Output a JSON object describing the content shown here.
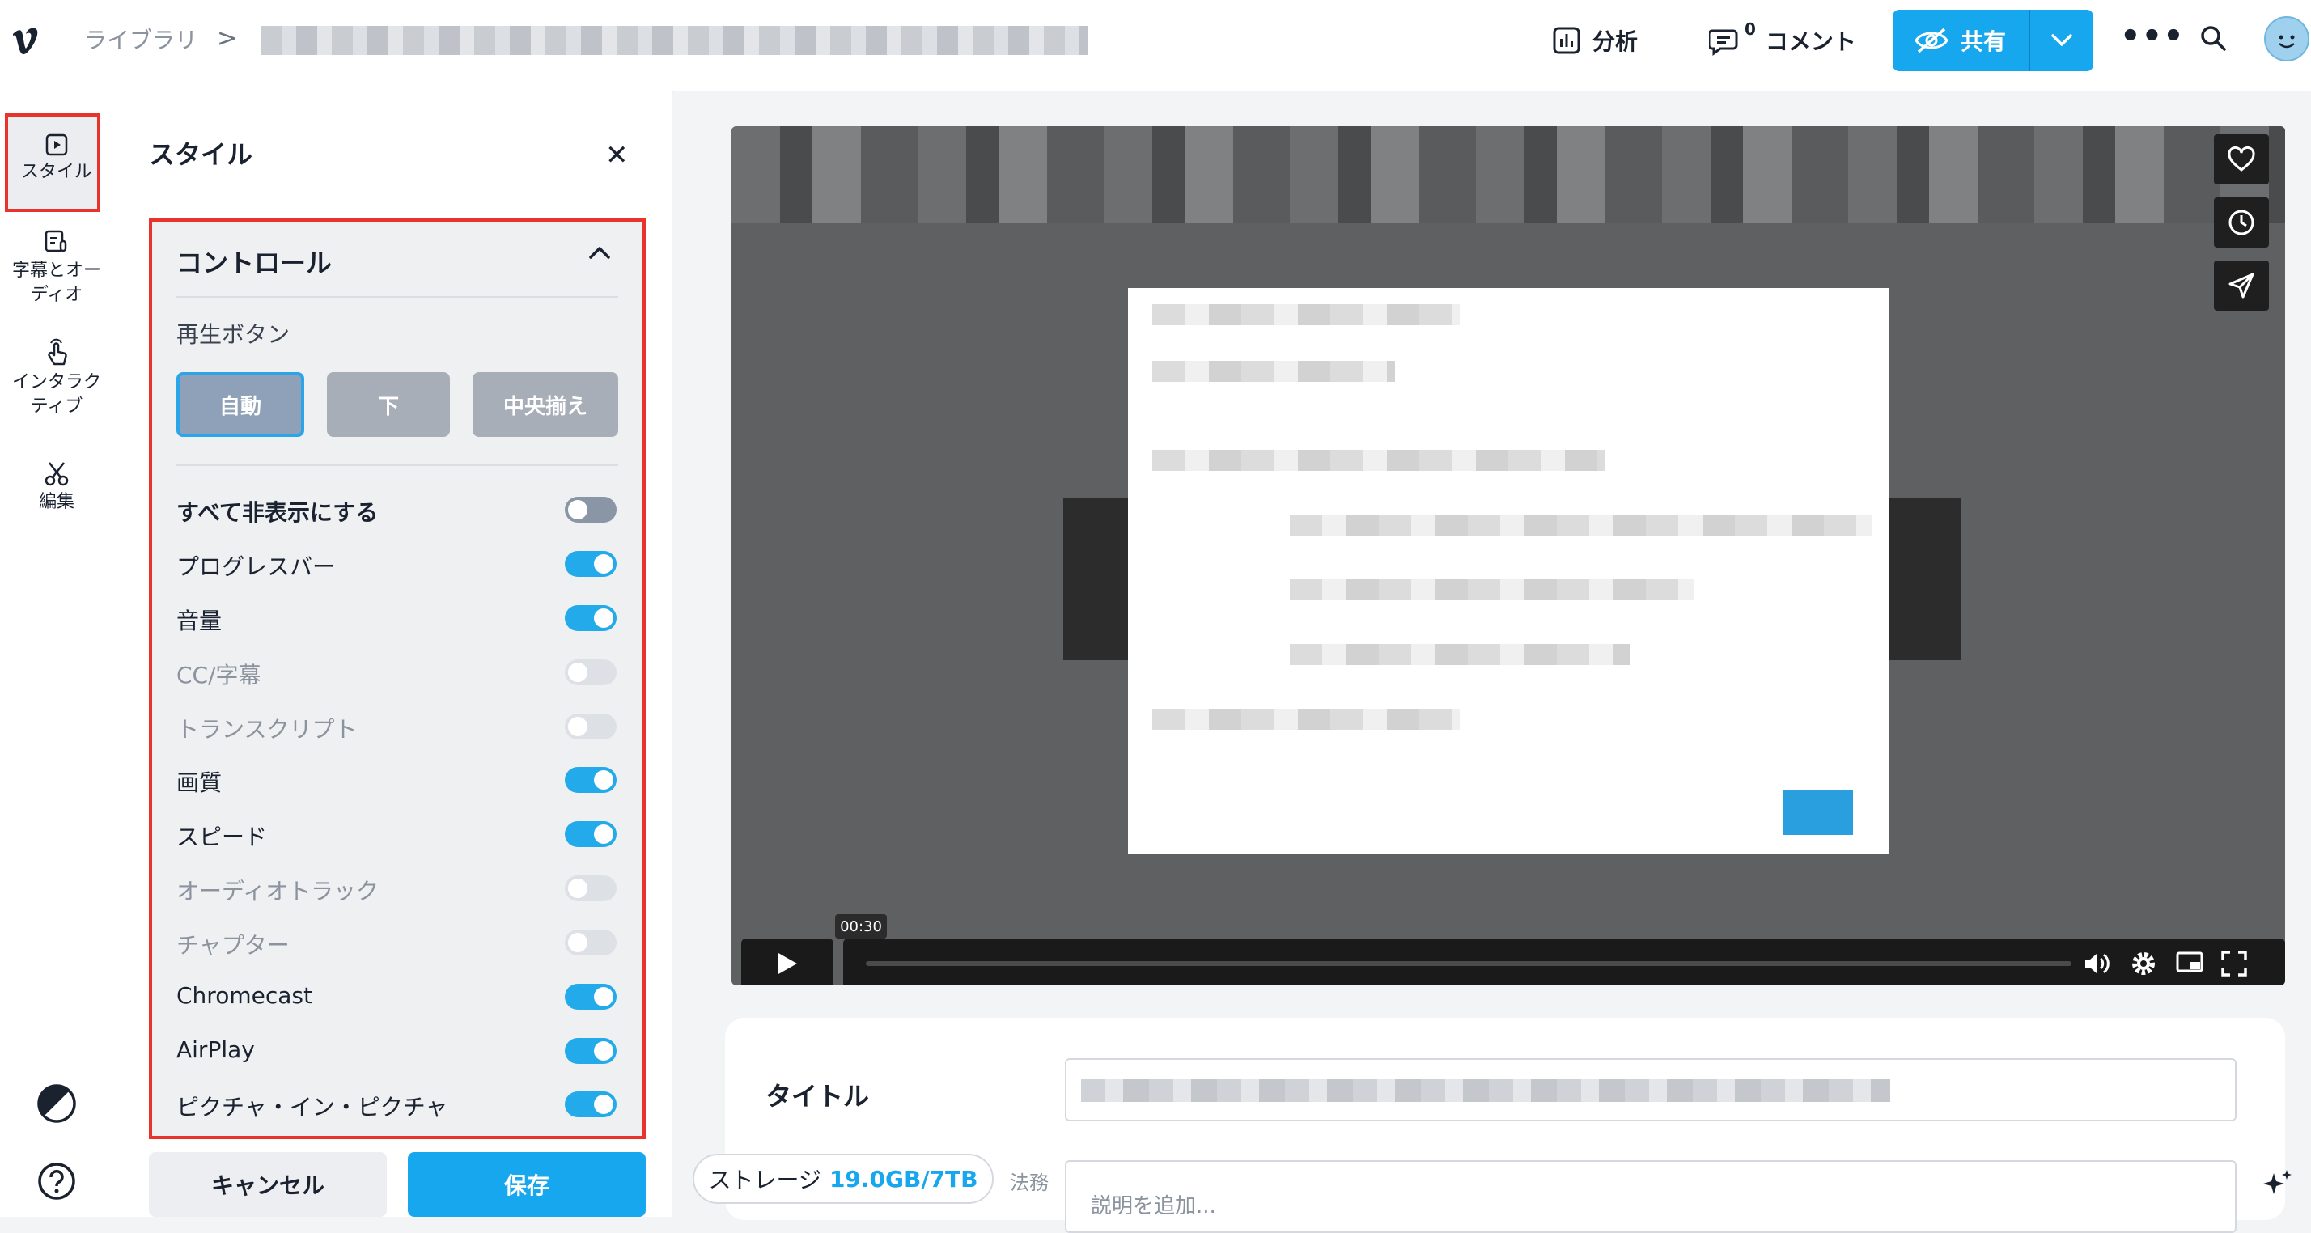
{
  "header": {
    "breadcrumb_library": "ライブラリ",
    "breadcrumb_separator": ">",
    "analytics_label": "分析",
    "comments_count": "0",
    "comments_label": "コメント",
    "share_label": "共有"
  },
  "rail": {
    "items": [
      {
        "label": "スタイル"
      },
      {
        "label": "字幕とオーディオ"
      },
      {
        "label": "インタラクティブ"
      },
      {
        "label": "編集"
      }
    ]
  },
  "panel": {
    "title": "スタイル",
    "controls_heading": "コントロール",
    "play_button_label": "再生ボタン",
    "play_button_options": [
      "自動",
      "下",
      "中央揃え"
    ],
    "toggles": [
      {
        "label": "すべて非表示にする",
        "state": "off",
        "bold": true
      },
      {
        "label": "プログレスバー",
        "state": "on"
      },
      {
        "label": "音量",
        "state": "on"
      },
      {
        "label": "CC/字幕",
        "state": "disabled"
      },
      {
        "label": "トランスクリプト",
        "state": "disabled"
      },
      {
        "label": "画質",
        "state": "on"
      },
      {
        "label": "スピード",
        "state": "on"
      },
      {
        "label": "オーディオトラック",
        "state": "disabled"
      },
      {
        "label": "チャプター",
        "state": "disabled"
      },
      {
        "label": "Chromecast",
        "state": "on"
      },
      {
        "label": "AirPlay",
        "state": "on"
      },
      {
        "label": "ピクチャ・イン・ピクチャ",
        "state": "on"
      }
    ],
    "cancel_label": "キャンセル",
    "save_label": "保存"
  },
  "player": {
    "time_chip": "00:30"
  },
  "details": {
    "title_label": "タイトル",
    "description_placeholder": "説明を追加..."
  },
  "storage": {
    "label": "ストレージ",
    "value": "19.0GB/7TB"
  },
  "legal_text": "法務",
  "colors": {
    "accent": "#17a7ee",
    "highlight_border": "#e8342d",
    "toggle_on": "#22aaea"
  }
}
